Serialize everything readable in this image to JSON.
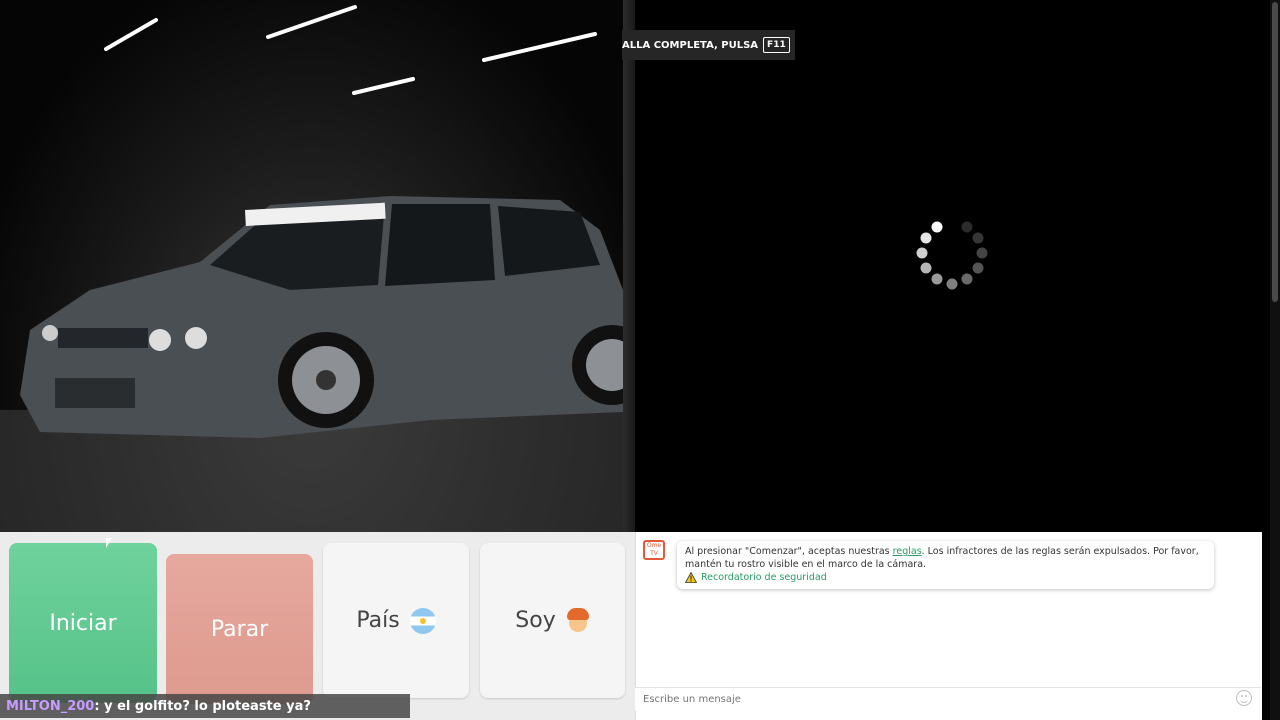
{
  "fullscreen_hint": {
    "text": "ALLA COMPLETA, PULSA",
    "key": "F11"
  },
  "controls": {
    "start_label": "Iniciar",
    "stop_label": "Parar",
    "country_label": "País",
    "gender_label": "Soy"
  },
  "chat": {
    "logo_text": "Ome TV",
    "notice_pre": "Al presionar \"Comenzar\", aceptas nuestras ",
    "notice_link": "reglas",
    "notice_post": ". Los infractores de las reglas serán expulsados. Por favor, mantén tu rostro visible en el marco de la cámara.",
    "safety_link": "Recordatorio de seguridad",
    "input_placeholder": "Escribe un mensaje"
  },
  "stream_chat": {
    "user": "MILTON_200",
    "message": ": y el golfito? lo ploteaste ya?"
  },
  "colors": {
    "start": "#5cc98e",
    "stop": "#e2a196",
    "link": "#2a9a66",
    "username": "#c79bff"
  }
}
